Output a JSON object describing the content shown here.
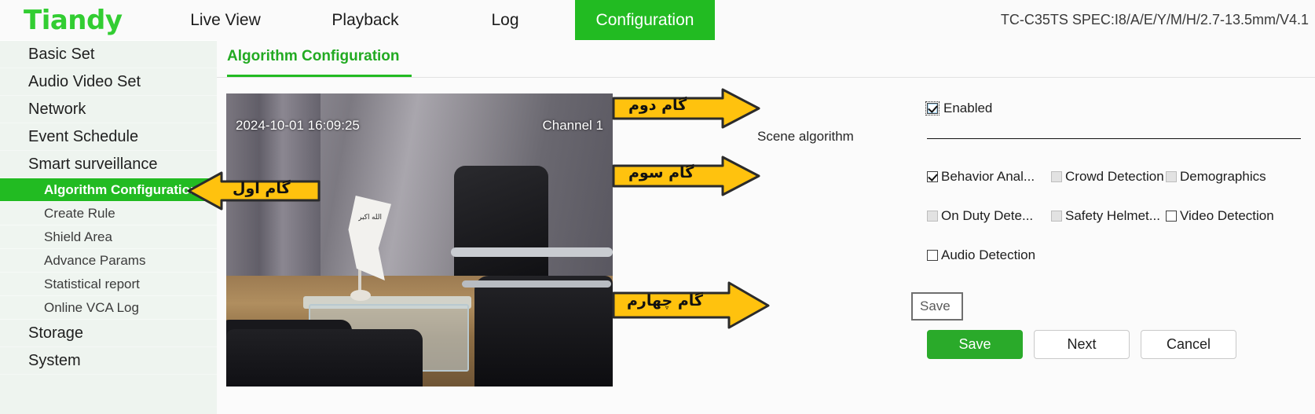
{
  "header": {
    "logo": "Tiandy",
    "tabs": [
      {
        "label": "Live View",
        "active": false
      },
      {
        "label": "Playback",
        "active": false
      },
      {
        "label": "Log",
        "active": false
      },
      {
        "label": "Configuration",
        "active": true
      }
    ],
    "device_model": "TC-C35TS SPEC:I8/A/E/Y/M/H/2.7-13.5mm/V4.1",
    "accent_color": "#22bb22"
  },
  "sidebar": {
    "items": [
      {
        "label": "Basic Set",
        "type": "group"
      },
      {
        "label": "Audio Video Set",
        "type": "group"
      },
      {
        "label": "Network",
        "type": "group"
      },
      {
        "label": "Event Schedule",
        "type": "group"
      },
      {
        "label": "Smart surveillance",
        "type": "group"
      }
    ],
    "sub_items": [
      {
        "label": "Algorithm Configuration",
        "active": true
      },
      {
        "label": "Create Rule",
        "active": false
      },
      {
        "label": "Shield Area",
        "active": false
      },
      {
        "label": "Advance Params",
        "active": false
      },
      {
        "label": "Statistical report",
        "active": false
      },
      {
        "label": "Online VCA Log",
        "active": false
      }
    ],
    "items_after": [
      {
        "label": "Storage",
        "type": "group"
      },
      {
        "label": "System",
        "type": "group"
      }
    ]
  },
  "main": {
    "tab_title": "Algorithm Configuration",
    "video": {
      "timestamp": "2024-10-01 16:09:25",
      "channel": "Channel 1",
      "flag_text": "الله اکبر"
    },
    "scene_label": "Scene algorithm",
    "enabled": {
      "label": "Enabled",
      "checked": true,
      "focused": true
    },
    "algorithms": [
      [
        {
          "label": "Behavior Anal...",
          "checked": true,
          "disabled": false
        },
        {
          "label": "Crowd Detection",
          "checked": false,
          "disabled": true
        },
        {
          "label": "Demographics",
          "checked": false,
          "disabled": true
        }
      ],
      [
        {
          "label": "On Duty Dete...",
          "checked": false,
          "disabled": true
        },
        {
          "label": "Safety Helmet...",
          "checked": false,
          "disabled": true
        },
        {
          "label": "Video Detection",
          "checked": false,
          "disabled": false
        }
      ],
      [
        {
          "label": "Audio Detection",
          "checked": false,
          "disabled": false
        }
      ]
    ],
    "tooltip": "Save",
    "buttons": [
      {
        "label": "Save",
        "style": "primary"
      },
      {
        "label": "Next",
        "style": "plain"
      },
      {
        "label": "Cancel",
        "style": "plain"
      }
    ]
  },
  "annotations": [
    {
      "name": "step-one",
      "label": "گام اول",
      "direction": "left"
    },
    {
      "name": "step-two",
      "label": "گام دوم",
      "direction": "right"
    },
    {
      "name": "step-three",
      "label": "گام سوم",
      "direction": "right"
    },
    {
      "name": "step-four",
      "label": "گام چهارم",
      "direction": "right"
    }
  ],
  "colors": {
    "arrow_fill": "#FFC20E",
    "arrow_stroke": "#2b2b2b",
    "brand_green": "#22bb22"
  }
}
